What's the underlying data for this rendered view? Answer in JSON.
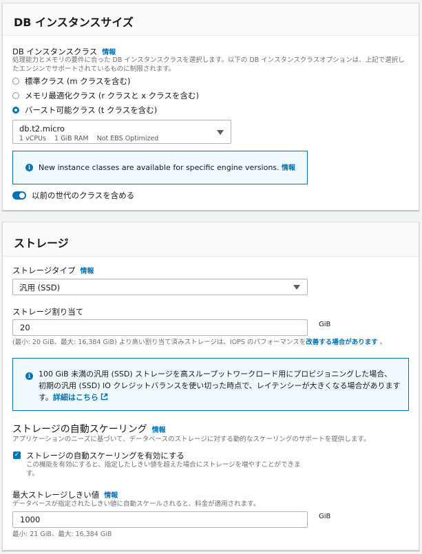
{
  "instance_size": {
    "title": "DB インスタンスサイズ",
    "class_label": "DB インスタンスクラス",
    "info": "情報",
    "class_desc_line1": "処理能力とメモリの要件に合った DB インスタンスクラスを選択します。以下の DB インスタンスクラスオプションは、上記で選択し",
    "class_desc_line2": "たエンジンでサポートされているものに制限されます。",
    "options": [
      {
        "label": "標準クラス (m クラスを含む)",
        "checked": false
      },
      {
        "label": "メモリ最適化クラス (r クラスと x クラスを含む)",
        "checked": false
      },
      {
        "label": "バースト可能クラス (t クラスを含む)",
        "checked": true
      }
    ],
    "selected_class": "db.t2.micro",
    "class_specs": "1 vCPUs    1 GiB RAM    Not EBS Optimized",
    "alert_text": "New instance classes are available for specific engine versions.",
    "alert_link": "情報",
    "toggle_label": "以前の世代のクラスを含める"
  },
  "storage": {
    "title": "ストレージ",
    "type_label": "ストレージタイプ",
    "info": "情報",
    "type_value": "汎用 (SSD)",
    "allocation_label": "ストレージ割り当て",
    "allocation_value": "20",
    "unit": "GiB",
    "allocation_hint": "(最小: 20 GiB、最大: 16,384 GiB) より高い割り当て済みストレージは、IOPS のパフォーマンスを",
    "allocation_hint_link": "改善する場合があります",
    "allocation_hint_end": "。",
    "alert_line1": "100 GiB 未満の汎用 (SSD) ストレージを高スループットワークロード用にプロビジョニングした場合、",
    "alert_line2": "初期の汎用 (SSD) IO クレジットバランスを使い切った時点で、レイテンシーが大きくなる場合があります",
    "alert_line3_prefix": "す。",
    "alert_link": "詳細はこちら",
    "autoscaling_title": "ストレージの自動スケーリング",
    "autoscaling_info": "情報",
    "autoscaling_desc": "アプリケーションのニーズに基づいて、データベースのストレージに対する動的なスケーリングのサポートを提供します。",
    "autoscaling_checkbox": "ストレージの自動スケーリングを有効にする",
    "autoscaling_checkbox_desc1": "この機能を有効にすると、指定したしきい値を超えた場合にストレージを増やすことができま",
    "autoscaling_checkbox_desc2": "す。",
    "max_label": "最大ストレージしきい値",
    "max_info": "情報",
    "max_desc": "データベースが指定されたしきい値に自動スケールされると、料金が適用されます。",
    "max_value": "1000",
    "max_hint": "最小: 21 GiB、最大: 16,384 GiB"
  },
  "colors": {
    "accent": "#0073bb",
    "border": "#aab7b8",
    "alert_bg": "#f1faff"
  }
}
